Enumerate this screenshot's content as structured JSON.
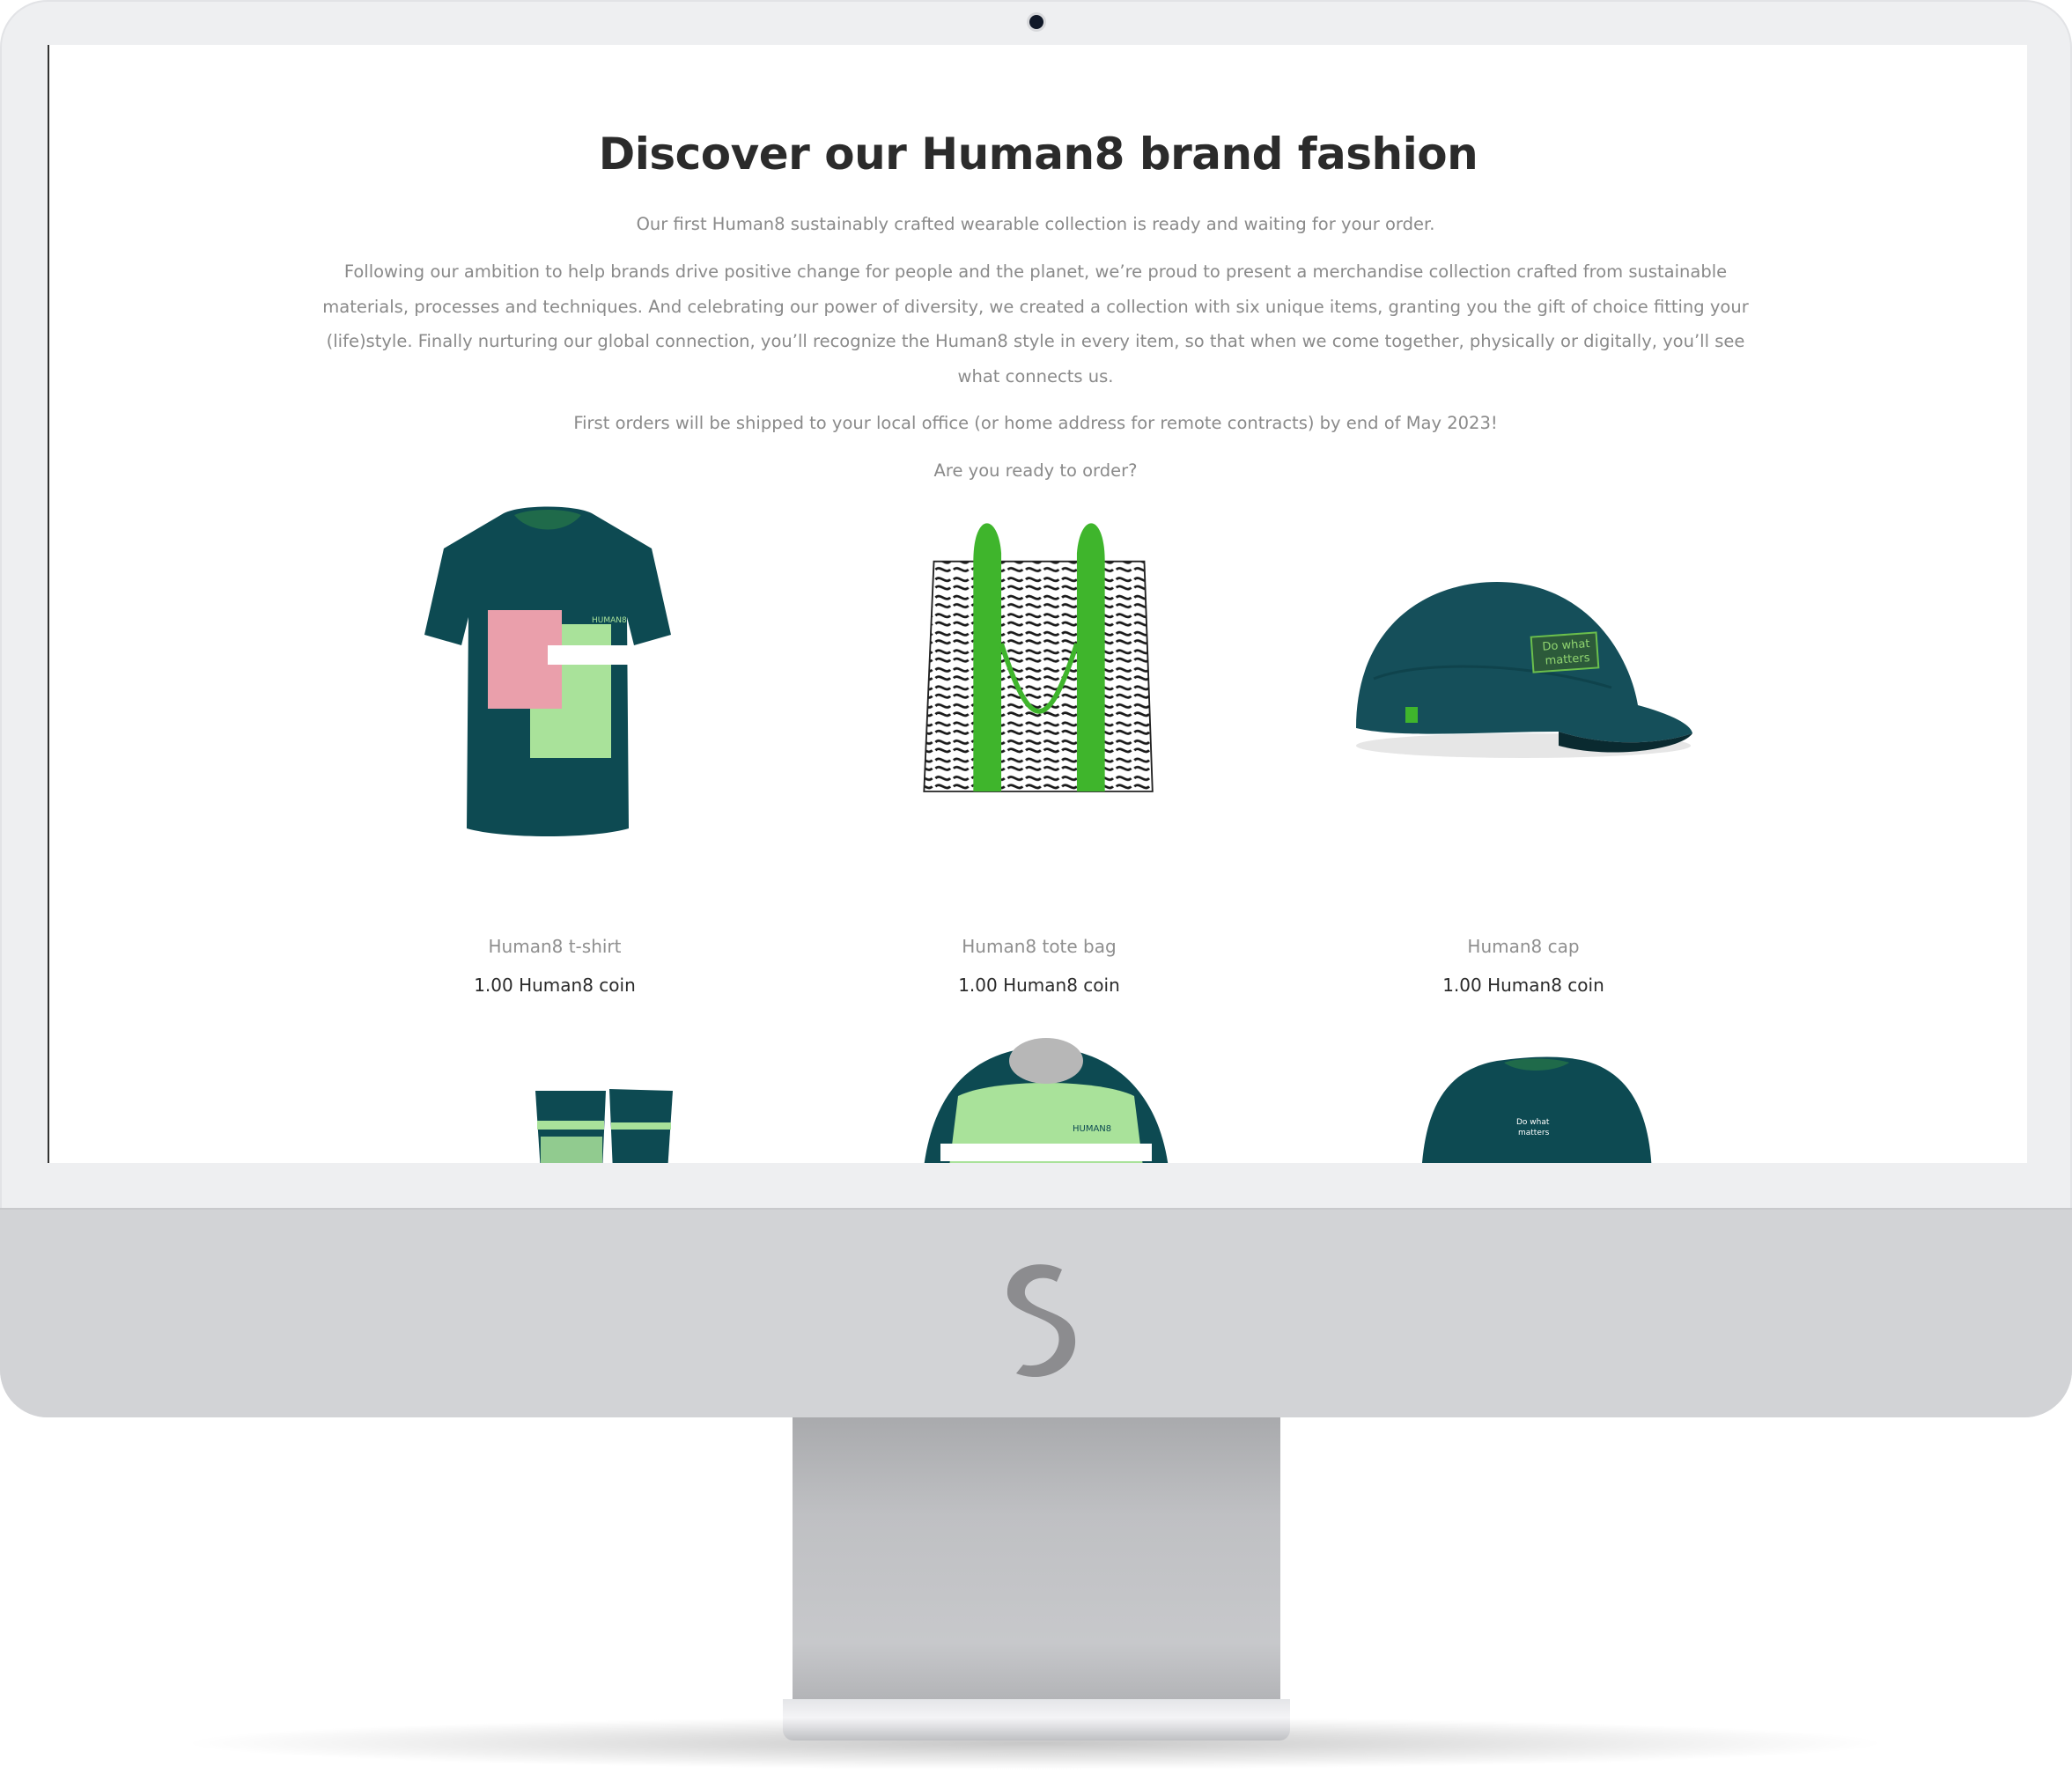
{
  "page": {
    "title": "Discover our Human8 brand fashion",
    "intro": "Our first Human8 sustainably crafted wearable collection is ready and waiting for your order.",
    "body": "Following our ambition to help brands drive positive change for people and the planet, we’re proud to present a merchandise collection crafted from sustainable materials, processes and techniques. And celebrating our power of diversity, we created a collection with six unique items, granting you the gift of choice fitting your (life)style. Finally nurturing our global connection, you’ll recognize the Human8 style in every item, so that when we come together, physically or digitally, you’ll see what connects us.",
    "shipping": "First orders will be shipped to your local office (or home address for remote contracts) by end of May 2023!",
    "cta": "Are you ready to order?"
  },
  "products": [
    {
      "name": "Human8 t-shirt",
      "price": "1.00 Human8 coin",
      "print": "HUMAN8"
    },
    {
      "name": "Human8 tote bag",
      "price": "1.00 Human8 coin"
    },
    {
      "name": "Human8 cap",
      "price": "1.00 Human8 coin",
      "patch_line1": "Do what",
      "patch_line2": "matters"
    }
  ],
  "partial_products": [
    {
      "icon": "socks-image"
    },
    {
      "icon": "sweater-image",
      "print": "HUMAN8"
    },
    {
      "icon": "tshirt-dark-image",
      "print_line1": "Do what",
      "print_line2": "matters"
    }
  ],
  "colors": {
    "teal": "#0d4a52",
    "green": "#3fb52c",
    "mint": "#a9e29a",
    "pink": "#ea9fab"
  }
}
